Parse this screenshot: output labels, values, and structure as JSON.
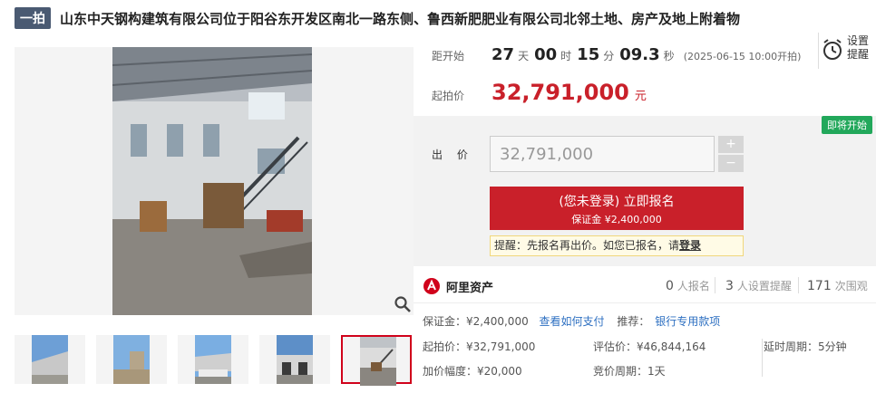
{
  "header": {
    "round_badge": "一拍",
    "title": "山东中天钢构建筑有限公司位于阳谷东开发区南北一路东侧、鲁西新肥肥业有限公司北邻土地、房产及地上附着物"
  },
  "countdown": {
    "label": "距开始",
    "days": "27",
    "days_unit": "天",
    "hours": "00",
    "hours_unit": "时",
    "minutes": "15",
    "minutes_unit": "分",
    "seconds": "09.3",
    "seconds_unit": "秒",
    "start_time": "(2025-06-15 10:00开拍)"
  },
  "start_price": {
    "label": "起拍价",
    "value": "32,791,000",
    "unit": "元"
  },
  "reminder": {
    "label": "设置提醒",
    "icon": "alarm-clock-icon"
  },
  "bid": {
    "status_badge": "即将开始",
    "label": "出 价",
    "input_value": "32,791,000",
    "plus": "+",
    "minus": "−",
    "register_line1": "(您未登录) 立即报名",
    "register_line2": "保证金 ¥2,400,000",
    "tip_text": "提醒：先报名再出价。如您已报名，请",
    "tip_link": "登录"
  },
  "platform": {
    "name": "阿里资产",
    "registered_count": "0",
    "registered_label": "人报名",
    "reminder_count": "3",
    "reminder_label": "人设置提醒",
    "view_count": "171",
    "view_label": "次围观"
  },
  "deposit": {
    "label": "保证金：¥2,400,000",
    "how_to_pay": "查看如何支付",
    "recommend_label": "推荐：",
    "bank_payment": "银行专用款项"
  },
  "details": {
    "start_price": "起拍价：¥32,791,000",
    "assessed_price": "评估价：¥46,844,164",
    "delay_period": "延时周期：5分钟",
    "increment": "加价幅度：¥20,000",
    "bidding_period": "竞价周期：1天"
  },
  "colors": {
    "accent_red": "#c9202a",
    "badge_green": "#22a85b",
    "link_blue": "#2d6fc1"
  }
}
